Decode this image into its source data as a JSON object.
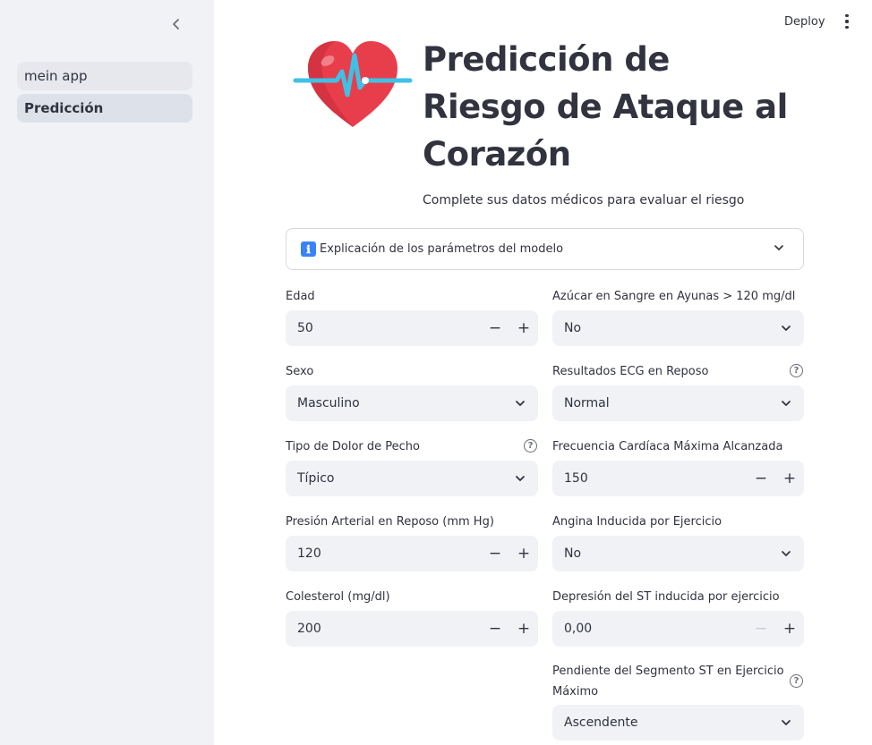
{
  "sidebar": {
    "items": [
      {
        "label": "mein app"
      },
      {
        "label": "Predicción"
      }
    ]
  },
  "topbar": {
    "deploy_label": "Deploy"
  },
  "header": {
    "title_lines": [
      "Predicción de",
      "Riesgo de Ataque al",
      "Corazón"
    ],
    "subtitle": "Complete sus datos médicos para evaluar el riesgo"
  },
  "expander": {
    "icon": "ℹ",
    "label": "Explicación de los parámetros del modelo"
  },
  "form": {
    "edad": {
      "label": "Edad",
      "value": "50"
    },
    "sexo": {
      "label": "Sexo",
      "value": "Masculino"
    },
    "dolor_pecho": {
      "label": "Tipo de Dolor de Pecho",
      "value": "Típico"
    },
    "presion": {
      "label": "Presión Arterial en Reposo (mm Hg)",
      "value": "120"
    },
    "colesterol": {
      "label": "Colesterol (mg/dl)",
      "value": "200"
    },
    "azucar": {
      "label": "Azúcar en Sangre en Ayunas > 120 mg/dl",
      "value": "No"
    },
    "ecg": {
      "label": "Resultados ECG en Reposo",
      "value": "Normal"
    },
    "frecuencia": {
      "label": "Frecuencia Cardíaca Máxima Alcanzada",
      "value": "150"
    },
    "angina": {
      "label": "Angina Inducida por Ejercicio",
      "value": "No"
    },
    "depresion_st": {
      "label": "Depresión del ST inducida por ejercicio",
      "value": "0,00"
    },
    "pendiente_st": {
      "label_line1": "Pendiente del Segmento ST en Ejercicio",
      "label_line2": "Máximo",
      "value": "Ascendente"
    }
  },
  "icons": {
    "help": "?",
    "minus": "−",
    "plus": "+"
  }
}
